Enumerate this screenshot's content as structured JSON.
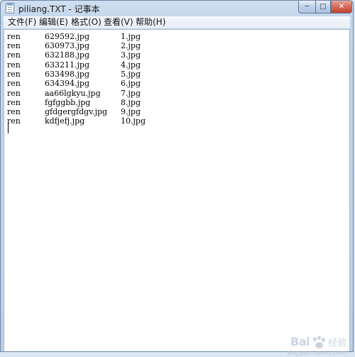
{
  "window": {
    "title": "piliang.TXT - 记事本",
    "controls": {
      "minimize": "─",
      "maximize": "□",
      "close": "✕"
    }
  },
  "menu": [
    {
      "label": "文件(F)"
    },
    {
      "label": "编辑(E)"
    },
    {
      "label": "格式(O)"
    },
    {
      "label": "查看(V)"
    },
    {
      "label": "帮助(H)"
    }
  ],
  "editor": {
    "lines": [
      {
        "cmd": "ren",
        "src": "629592.jpg",
        "dst": "1.jpg"
      },
      {
        "cmd": "ren",
        "src": "630973.jpg",
        "dst": "2.jpg"
      },
      {
        "cmd": "ren",
        "src": "632188.jpg",
        "dst": "3.jpg"
      },
      {
        "cmd": "ren",
        "src": "633211.jpg",
        "dst": "4.jpg"
      },
      {
        "cmd": "ren",
        "src": "633498.jpg",
        "dst": "5.jpg"
      },
      {
        "cmd": "ren",
        "src": "634394.jpg",
        "dst": "6.jpg"
      },
      {
        "cmd": "ren",
        "src": "aa66lgkyu.jpg",
        "dst": "7.jpg"
      },
      {
        "cmd": "ren",
        "src": "fgfggbb.jpg",
        "dst": "8.jpg"
      },
      {
        "cmd": "ren",
        "src": "gfdgergfdgv.jpg",
        "dst": "9.jpg"
      },
      {
        "cmd": "ren",
        "src": "kdfjefj.jpg",
        "dst": "10.jpg"
      }
    ]
  },
  "watermark": {
    "brand": "Bai",
    "brand_suffix": "经验",
    "url": "jingyan.baidu.com"
  }
}
